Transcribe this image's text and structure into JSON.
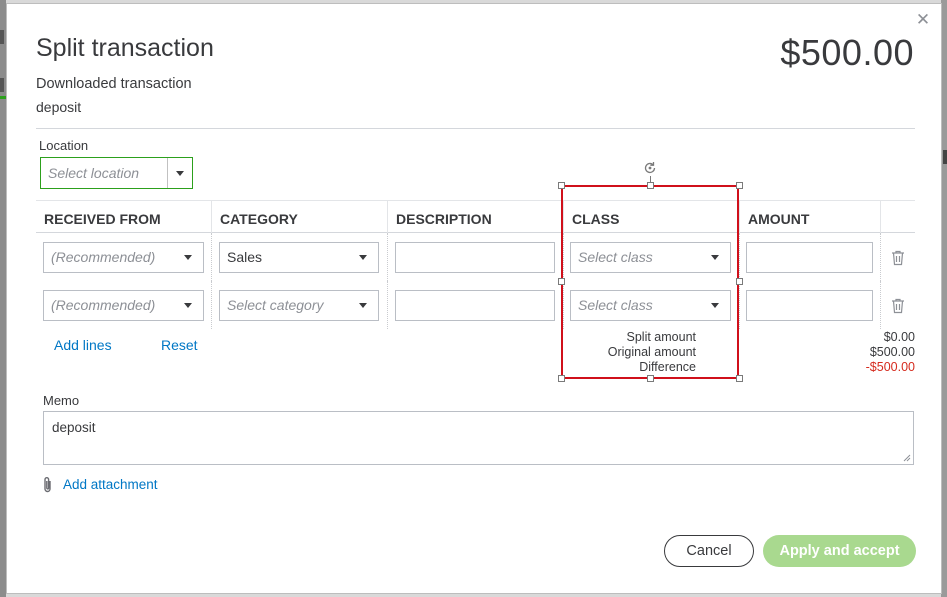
{
  "modal": {
    "title": "Split transaction",
    "total": "$500.00",
    "source_heading": "Downloaded transaction",
    "source_value": "deposit"
  },
  "location": {
    "label": "Location",
    "placeholder": "Select location"
  },
  "table": {
    "columns": [
      "RECEIVED FROM",
      "CATEGORY",
      "DESCRIPTION",
      "CLASS",
      "AMOUNT"
    ],
    "rows": [
      {
        "received_from": "(Recommended)",
        "category": "Sales",
        "category_is_placeholder": false,
        "description": "",
        "class": "Select class",
        "amount": ""
      },
      {
        "received_from": "(Recommended)",
        "category": "Select category",
        "category_is_placeholder": true,
        "description": "",
        "class": "Select class",
        "amount": ""
      }
    ]
  },
  "actions": {
    "add_lines": "Add lines",
    "reset": "Reset"
  },
  "summary": {
    "split_amount_label": "Split amount",
    "split_amount": "$0.00",
    "original_amount_label": "Original amount",
    "original_amount": "$500.00",
    "difference_label": "Difference",
    "difference": "-$500.00"
  },
  "memo": {
    "label": "Memo",
    "value": "deposit"
  },
  "attachment": {
    "label": "Add attachment"
  },
  "footer": {
    "cancel": "Cancel",
    "apply": "Apply and accept"
  },
  "colors": {
    "brand_green": "#2ca01c",
    "apply_disabled": "#a9d98f",
    "link_blue": "#0077c5",
    "negative_red": "#d52b1e",
    "selection_red": "#d0101b"
  },
  "icons": [
    "close-icon",
    "chevron-down-icon",
    "trash-icon",
    "paperclip-icon",
    "rotate-icon"
  ]
}
